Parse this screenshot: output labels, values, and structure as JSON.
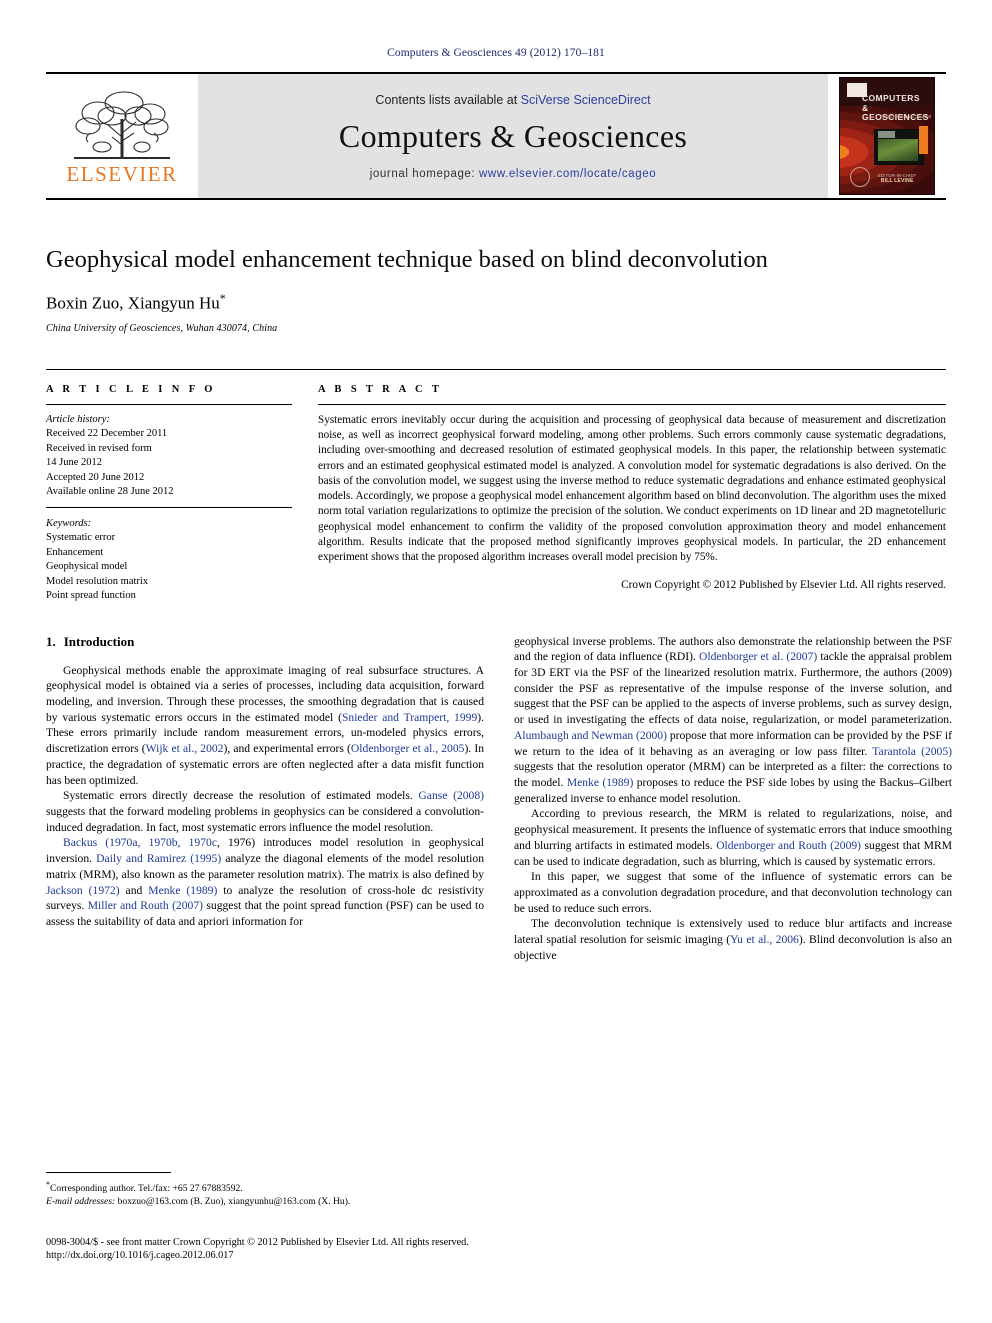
{
  "running_head": "Computers & Geosciences 49 (2012) 170–181",
  "masthead": {
    "contents_prefix": "Contents lists available at ",
    "contents_link": "SciVerse ScienceDirect",
    "journal_title": "Computers & Geosciences",
    "homepage_prefix": "journal homepage: ",
    "homepage_link": "www.elsevier.com/locate/cageo",
    "publisher_wordmark": "ELSEVIER",
    "cover": {
      "title_line1": "COMPUTERS &",
      "title_line2": "GEOSCIENCES",
      "subtitle": "An International Journal",
      "editor_label": "EDITOR-IN-CHIEF",
      "editor_name": "BILL LEVINE"
    }
  },
  "article": {
    "title": "Geophysical model enhancement technique based on blind deconvolution",
    "authors": "Boxin Zuo, Xiangyun Hu",
    "author_marker": "*",
    "affiliation": "China University of Geosciences, Wuhan 430074, China"
  },
  "info": {
    "label": "A R T I C L E   I N F O",
    "history_title": "Article history:",
    "history": [
      "Received 22 December 2011",
      "Received in revised form",
      "14 June 2012",
      "Accepted 20 June 2012",
      "Available online 28 June 2012"
    ],
    "keywords_title": "Keywords:",
    "keywords": [
      "Systematic error",
      "Enhancement",
      "Geophysical model",
      "Model resolution matrix",
      "Point spread function"
    ]
  },
  "abstract": {
    "label": "A B S T R A C T",
    "text": "Systematic errors inevitably occur during the acquisition and processing of geophysical data because of measurement and discretization noise, as well as incorrect geophysical forward modeling, among other problems. Such errors commonly cause systematic degradations, including over-smoothing and decreased resolution of estimated geophysical models. In this paper, the relationship between systematic errors and an estimated geophysical estimated model is analyzed. A convolution model for systematic degradations is also derived. On the basis of the convolution model, we suggest using the inverse method to reduce systematic degradations and enhance estimated geophysical models. Accordingly, we propose a geophysical model enhancement algorithm based on blind deconvolution. The algorithm uses the mixed norm total variation regularizations to optimize the precision of the solution. We conduct experiments on 1D linear and 2D magnetotelluric geophysical model enhancement to confirm the validity of the proposed convolution approximation theory and model enhancement algorithm. Results indicate that the proposed method significantly improves geophysical models. In particular, the 2D enhancement experiment shows that the proposed algorithm increases overall model precision by 75%.",
    "copyright": "Crown Copyright © 2012 Published by Elsevier Ltd. All rights reserved."
  },
  "introduction": {
    "number": "1.",
    "heading": "Introduction",
    "left_paragraphs": [
      {
        "runs": [
          {
            "t": "Geophysical methods enable the approximate imaging of real subsurface structures. A geophysical model is obtained via a series of processes, including data acquisition, forward modeling, and inversion. Through these processes, the smoothing degradation that is caused by various systematic errors occurs in the estimated model ("
          },
          {
            "t": "Snieder and Trampert, 1999",
            "c": true
          },
          {
            "t": "). These errors primarily include random measurement errors, un-modeled physics errors, discretization errors ("
          },
          {
            "t": "Wijk et al., 2002",
            "c": true
          },
          {
            "t": "), and experimental errors ("
          },
          {
            "t": "Oldenborger et al., 2005",
            "c": true
          },
          {
            "t": "). In practice, the degradation of systematic errors are often neglected after a data misfit function has been optimized."
          }
        ]
      },
      {
        "runs": [
          {
            "t": "Systematic errors directly decrease the resolution of estimated models. "
          },
          {
            "t": "Ganse (2008)",
            "c": true
          },
          {
            "t": " suggests that the forward modeling problems in geophysics can be considered a convolution-induced degradation. In fact, most systematic errors influence the model resolution."
          }
        ]
      },
      {
        "runs": [
          {
            "t": "Backus (1970a, 1970b, 1970c",
            "c": true
          },
          {
            "t": ", 1976) introduces model resolution in geophysical inversion. "
          },
          {
            "t": "Daily and Ramirez (1995)",
            "c": true
          },
          {
            "t": " analyze the diagonal elements of the model resolution matrix (MRM), also known as the parameter resolution matrix). The matrix is also defined by "
          },
          {
            "t": "Jackson (1972)",
            "c": true
          },
          {
            "t": " and "
          },
          {
            "t": "Menke (1989)",
            "c": true
          },
          {
            "t": " to analyze the resolution of cross-hole dc resistivity surveys. "
          },
          {
            "t": "Miller and Routh (2007)",
            "c": true
          },
          {
            "t": " suggest that the point spread function (PSF) can be used to assess the suitability of data and apriori information for"
          }
        ]
      }
    ],
    "right_paragraphs": [
      {
        "noindent": true,
        "runs": [
          {
            "t": "geophysical inverse problems. The authors also demonstrate the relationship between the PSF and the region of data influence (RDI). "
          },
          {
            "t": "Oldenborger et al. (2007)",
            "c": true
          },
          {
            "t": " tackle the appraisal problem for 3D ERT via the PSF of the linearized resolution matrix. Furthermore, the authors (2009) consider the PSF as representative of the impulse response of the inverse solution, and suggest that the PSF can be applied to the aspects of inverse problems, such as survey design, or used in investigating the effects of data noise, regularization, or model parameterization. "
          },
          {
            "t": "Alumbaugh and Newman (2000)",
            "c": true
          },
          {
            "t": " propose that more information can be provided by the PSF if we return to the idea of it behaving as an averaging or low pass filter. "
          },
          {
            "t": "Tarantola (2005)",
            "c": true
          },
          {
            "t": " suggests that the resolution operator (MRM) can be interpreted as a filter: the corrections to the model. "
          },
          {
            "t": "Menke (1989)",
            "c": true
          },
          {
            "t": " proposes to reduce the PSF side lobes by using the Backus–Gilbert generalized inverse to enhance model resolution."
          }
        ]
      },
      {
        "runs": [
          {
            "t": "According to previous research, the MRM is related to regularizations, noise, and geophysical measurement. It presents the influence of systematic errors that induce smoothing and blurring artifacts in estimated models. "
          },
          {
            "t": "Oldenborger and Routh (2009)",
            "c": true
          },
          {
            "t": " suggest that MRM can be used to indicate degradation, such as blurring, which is caused by systematic errors."
          }
        ]
      },
      {
        "runs": [
          {
            "t": "In this paper, we suggest that some of the influence of systematic errors can be approximated as a convolution degradation procedure, and that deconvolution technology can be used to reduce such errors."
          }
        ]
      },
      {
        "runs": [
          {
            "t": "The deconvolution technique is extensively used to reduce blur artifacts and increase lateral spatial resolution for seismic imaging ("
          },
          {
            "t": "Yu et al., 2006",
            "c": true
          },
          {
            "t": "). Blind deconvolution is also an objective"
          }
        ]
      }
    ]
  },
  "footnotes": {
    "corresponding": "Corresponding author. Tel./fax: +65 27 67883592.",
    "email_label": "E-mail addresses:",
    "emails": "boxzuo@163.com (B. Zuo), xiangyunhu@163.com (X. Hu)."
  },
  "footer": {
    "issn_line": "0098-3004/$ - see front matter Crown Copyright © 2012 Published by Elsevier Ltd. All rights reserved.",
    "doi_line": "http://dx.doi.org/10.1016/j.cageo.2012.06.017"
  }
}
